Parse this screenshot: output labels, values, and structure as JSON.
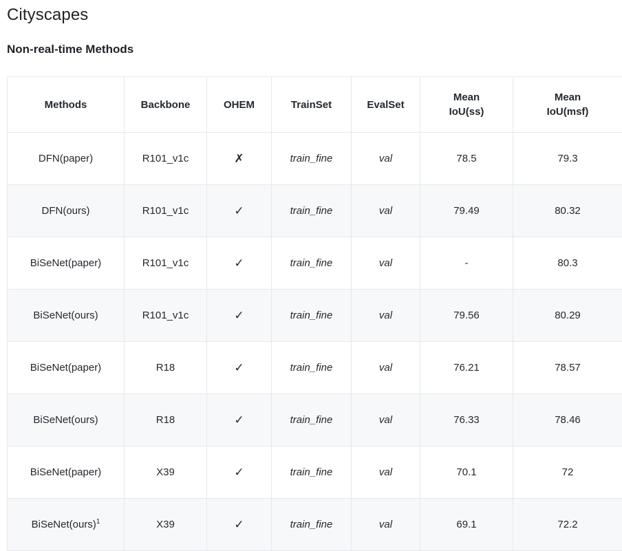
{
  "page": {
    "title": "Cityscapes",
    "section_title": "Non-real-time Methods"
  },
  "table": {
    "headers": [
      {
        "line1": "Methods",
        "line2": ""
      },
      {
        "line1": "Backbone",
        "line2": ""
      },
      {
        "line1": "OHEM",
        "line2": ""
      },
      {
        "line1": "TrainSet",
        "line2": ""
      },
      {
        "line1": "EvalSet",
        "line2": ""
      },
      {
        "line1": "Mean",
        "line2": "IoU(ss)"
      },
      {
        "line1": "Mean",
        "line2": "IoU(msf)"
      }
    ],
    "rows": [
      {
        "method": "DFN(paper)",
        "method_sup": "",
        "backbone": "R101_v1c",
        "ohem": "✗",
        "ohem_name": "cross-mark-icon",
        "trainset": "train_fine",
        "evalset": "val",
        "miou_ss": "78.5",
        "miou_msf": "79.3"
      },
      {
        "method": "DFN(ours)",
        "method_sup": "",
        "backbone": "R101_v1c",
        "ohem": "✓",
        "ohem_name": "check-mark-icon",
        "trainset": "train_fine",
        "evalset": "val",
        "miou_ss": "79.49",
        "miou_msf": "80.32"
      },
      {
        "method": "BiSeNet(paper)",
        "method_sup": "",
        "backbone": "R101_v1c",
        "ohem": "✓",
        "ohem_name": "check-mark-icon",
        "trainset": "train_fine",
        "evalset": "val",
        "miou_ss": "-",
        "miou_msf": "80.3"
      },
      {
        "method": "BiSeNet(ours)",
        "method_sup": "",
        "backbone": "R101_v1c",
        "ohem": "✓",
        "ohem_name": "check-mark-icon",
        "trainset": "train_fine",
        "evalset": "val",
        "miou_ss": "79.56",
        "miou_msf": "80.29"
      },
      {
        "method": "BiSeNet(paper)",
        "method_sup": "",
        "backbone": "R18",
        "ohem": "✓",
        "ohem_name": "check-mark-icon",
        "trainset": "train_fine",
        "evalset": "val",
        "miou_ss": "76.21",
        "miou_msf": "78.57"
      },
      {
        "method": "BiSeNet(ours)",
        "method_sup": "",
        "backbone": "R18",
        "ohem": "✓",
        "ohem_name": "check-mark-icon",
        "trainset": "train_fine",
        "evalset": "val",
        "miou_ss": "76.33",
        "miou_msf": "78.46"
      },
      {
        "method": "BiSeNet(paper)",
        "method_sup": "",
        "backbone": "X39",
        "ohem": "✓",
        "ohem_name": "check-mark-icon",
        "trainset": "train_fine",
        "evalset": "val",
        "miou_ss": "70.1",
        "miou_msf": "72"
      },
      {
        "method": "BiSeNet(ours)",
        "method_sup": "1",
        "backbone": "X39",
        "ohem": "✓",
        "ohem_name": "check-mark-icon",
        "trainset": "train_fine",
        "evalset": "val",
        "miou_ss": "69.1",
        "miou_msf": "72.2"
      }
    ]
  },
  "colors": {
    "text": "#24292f",
    "heading": "#1f2328",
    "border": "#e6e8eb",
    "alt_row": "#f6f8fa",
    "background": "#ffffff"
  }
}
